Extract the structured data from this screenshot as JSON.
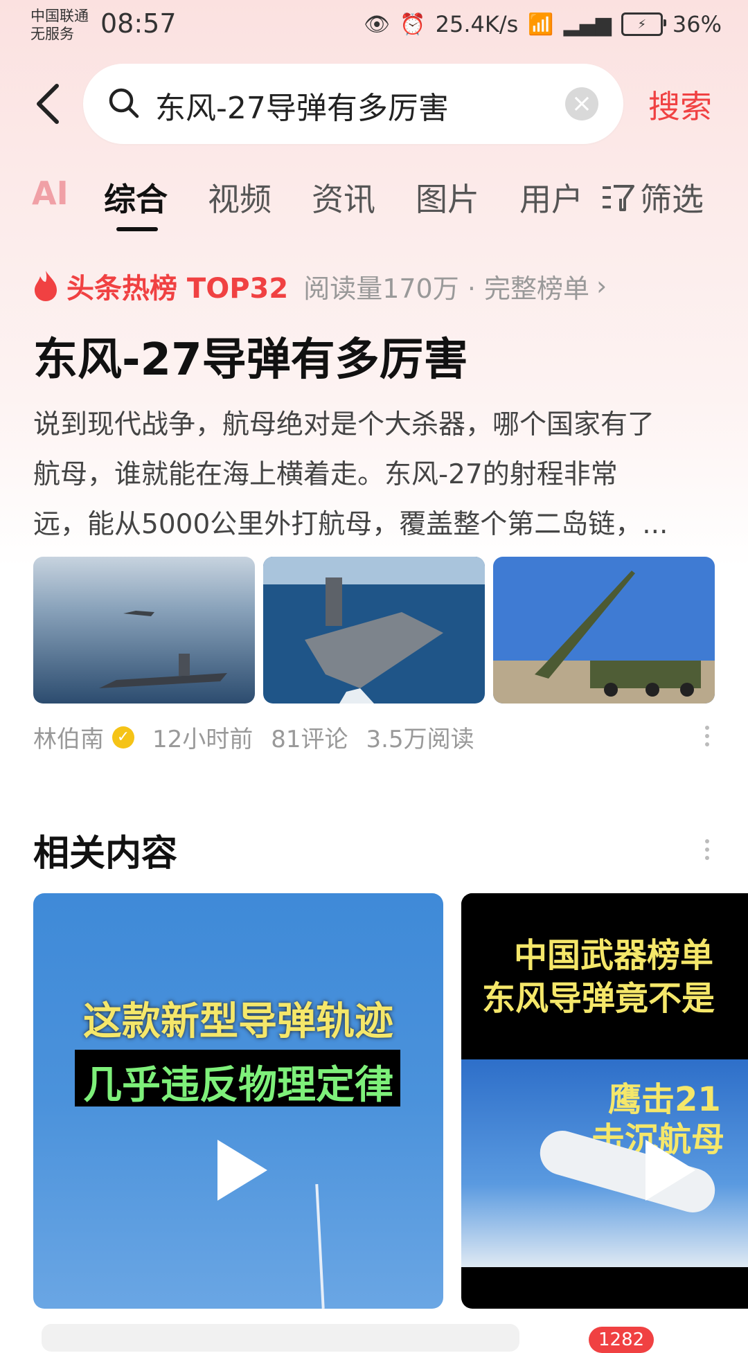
{
  "status_bar": {
    "carrier_line1": "中国联通",
    "carrier_line2": "无服务",
    "time": "08:57",
    "net_speed": "25.4K/s",
    "battery": "36%"
  },
  "search": {
    "query": "东风-27导弹有多厉害",
    "button": "搜索"
  },
  "tabs": [
    "AI",
    "综合",
    "视频",
    "资讯",
    "图片",
    "用户"
  ],
  "filter_label": "筛选",
  "hot": {
    "label": "头条热榜 TOP32",
    "meta": "阅读量170万 · 完整榜单",
    "chevron": "›"
  },
  "article": {
    "title": "东风-27导弹有多厉害",
    "snippet_lines": [
      "说到现代战争，航母绝对是个大杀器，哪个国家有了",
      "航母，谁就能在海上横着走。东风-27的射程非常",
      "远，能从5000公里外打航母，覆盖整个第二岛链，..."
    ],
    "author": "林伯南",
    "time": "12小时前",
    "comments": "81评论",
    "reads": "3.5万阅读"
  },
  "related": {
    "title": "相关内容",
    "card1_line1": "这款新型导弹轨迹",
    "card1_line2": "几乎违反物理定律",
    "card2_line1": "中国武器榜单",
    "card2_line2": "东风导弹竟不是",
    "card2_line3": "鹰击21",
    "card2_line4": "击沉航母"
  },
  "bottom": {
    "badge": "1282"
  },
  "colors": {
    "accent_red": "#f04142",
    "text_dark": "#111111",
    "text_gray": "#999999"
  }
}
